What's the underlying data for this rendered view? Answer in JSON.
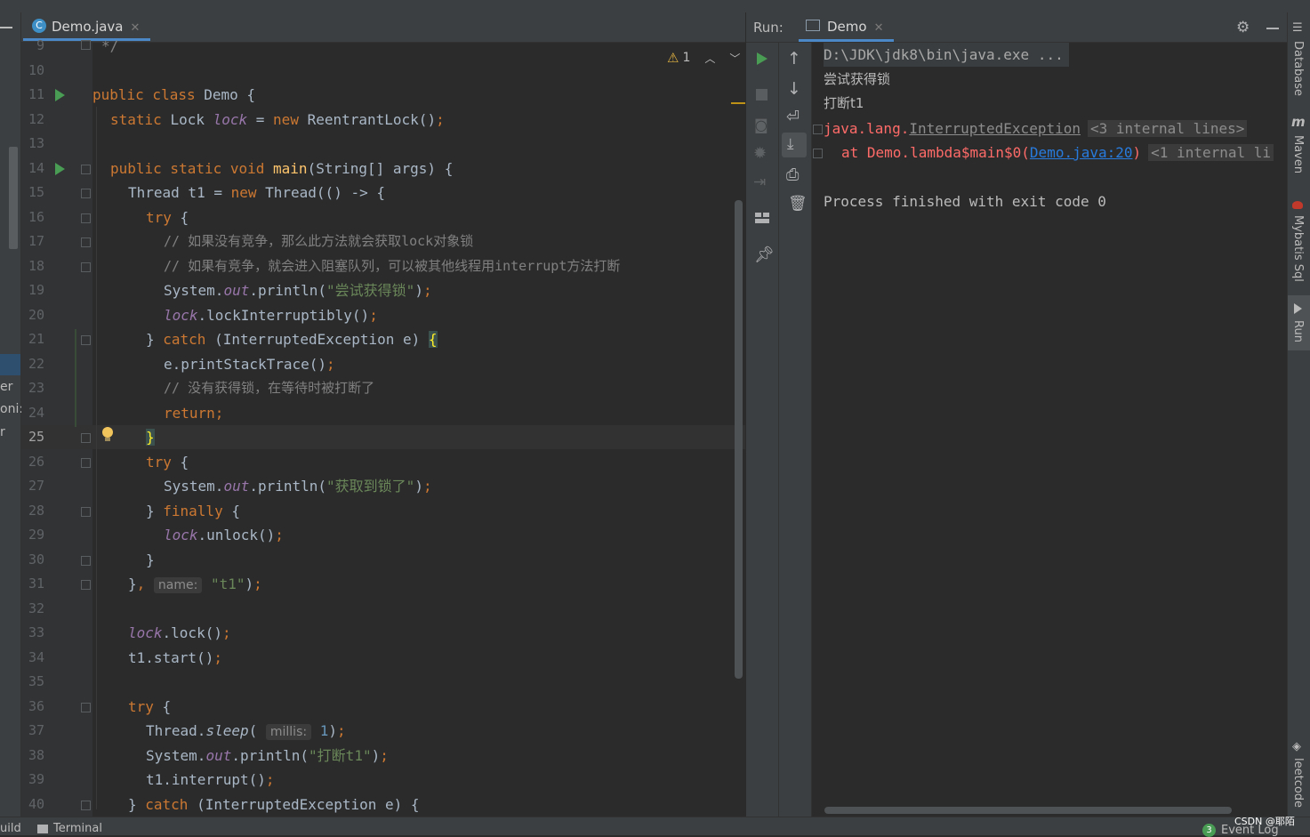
{
  "editor": {
    "tab_label": "Demo.java",
    "warnings": "1",
    "lines": [
      {
        "n": "9"
      },
      {
        "n": "10"
      },
      {
        "n": "11"
      },
      {
        "n": "12"
      },
      {
        "n": "13"
      },
      {
        "n": "14"
      },
      {
        "n": "15"
      },
      {
        "n": "16"
      },
      {
        "n": "17"
      },
      {
        "n": "18"
      },
      {
        "n": "19"
      },
      {
        "n": "20"
      },
      {
        "n": "21"
      },
      {
        "n": "22"
      },
      {
        "n": "23"
      },
      {
        "n": "24"
      },
      {
        "n": "25"
      },
      {
        "n": "26"
      },
      {
        "n": "27"
      },
      {
        "n": "28"
      },
      {
        "n": "29"
      },
      {
        "n": "30"
      },
      {
        "n": "31"
      },
      {
        "n": "32"
      },
      {
        "n": "33"
      },
      {
        "n": "34"
      },
      {
        "n": "35"
      },
      {
        "n": "36"
      },
      {
        "n": "37"
      },
      {
        "n": "38"
      },
      {
        "n": "39"
      },
      {
        "n": "40"
      }
    ],
    "code": {
      "l9": "*/",
      "l11_a": "public class ",
      "l11_b": "Demo {",
      "l12_a": "static ",
      "l12_b": "Lock ",
      "l12_c": "lock",
      "l12_d": " = ",
      "l12_e": "new ",
      "l12_f": "ReentrantLock()",
      "l12_g": ";",
      "l14_a": "public static void ",
      "l14_b": "main",
      "l14_c": "(String[] args) {",
      "l15_a": "Thread t1 = ",
      "l15_b": "new ",
      "l15_c": "Thread(() -> {",
      "l16_a": "try ",
      "l16_b": "{",
      "l17": "// 如果没有竞争，那么此方法就会获取lock对象锁",
      "l18": "// 如果有竞争，就会进入阻塞队列，可以被其他线程用interrupt方法打断",
      "l19_a": "System.",
      "l19_b": "out",
      "l19_c": ".println(",
      "l19_d": "\"尝试获得锁\"",
      "l19_e": ")",
      "l19_f": ";",
      "l20_a": "lock",
      "l20_b": ".lockInterruptibly()",
      "l20_c": ";",
      "l21_a": "} ",
      "l21_b": "catch ",
      "l21_c": "(InterruptedException e) ",
      "l21_d": "{",
      "l22_a": "e.printStackTrace()",
      "l22_b": ";",
      "l23": "// 没有获得锁，在等待时被打断了",
      "l24": "return;",
      "l25": "}",
      "l26_a": "try ",
      "l26_b": "{",
      "l27_a": "System.",
      "l27_b": "out",
      "l27_c": ".println(",
      "l27_d": "\"获取到锁了\"",
      "l27_e": ")",
      "l27_f": ";",
      "l28_a": "} ",
      "l28_b": "finally ",
      "l28_c": "{",
      "l29_a": "lock",
      "l29_b": ".unlock()",
      "l29_c": ";",
      "l30": "}",
      "l31_a": "}",
      "l31_b": ", ",
      "l31_hint": "name:",
      "l31_c": "\"t1\"",
      "l31_d": ")",
      "l31_e": ";",
      "l33_a": "lock",
      "l33_b": ".lock()",
      "l33_c": ";",
      "l34_a": "t1.start()",
      "l34_b": ";",
      "l36_a": "try ",
      "l36_b": "{",
      "l37_a": "Thread.",
      "l37_b": "sleep",
      "l37_c": "( ",
      "l37_hint": "millis:",
      "l37_d": "1",
      "l37_e": ")",
      "l37_f": ";",
      "l38_a": "System.",
      "l38_b": "out",
      "l38_c": ".println(",
      "l38_d": "\"打断t1\"",
      "l38_e": ")",
      "l38_f": ";",
      "l39_a": "t1.interrupt()",
      "l39_b": ";",
      "l40_a": "} ",
      "l40_b": "catch ",
      "l40_c": "(InterruptedException e) {"
    }
  },
  "run": {
    "label": "Run:",
    "tab_label": "Demo",
    "console": {
      "cmd": "D:\\JDK\\jdk8\\bin\\java.exe ...",
      "out1": "尝试获得锁",
      "out2": "打断t1",
      "exc_pkg": "java.lang.",
      "exc_name": "InterruptedException",
      "exc_fold": "<3 internal lines>",
      "at_prefix": "at Demo.lambda$main$0(",
      "at_link": "Demo.java:20",
      "at_suffix": ")",
      "at_fold": "<1 internal li",
      "finished": "Process finished with exit code 0"
    }
  },
  "right_tools": {
    "database": "Database",
    "maven": "Maven",
    "mybatis": "Mybatis Sql",
    "run": "Run",
    "leetcode": "leetcode"
  },
  "left_tools": {
    "frag1": "er",
    "frag2": "oni:",
    "frag3": "r"
  },
  "status": {
    "build": "uild",
    "terminal": "Terminal",
    "event_count": "3",
    "event_log": "Event Log",
    "watermark": "CSDN @耶陌"
  },
  "colors": {
    "background": "#2b2b2b",
    "keyword": "#cc7832",
    "string": "#6a8759",
    "error": "#ff6b68",
    "link": "#287bde"
  }
}
